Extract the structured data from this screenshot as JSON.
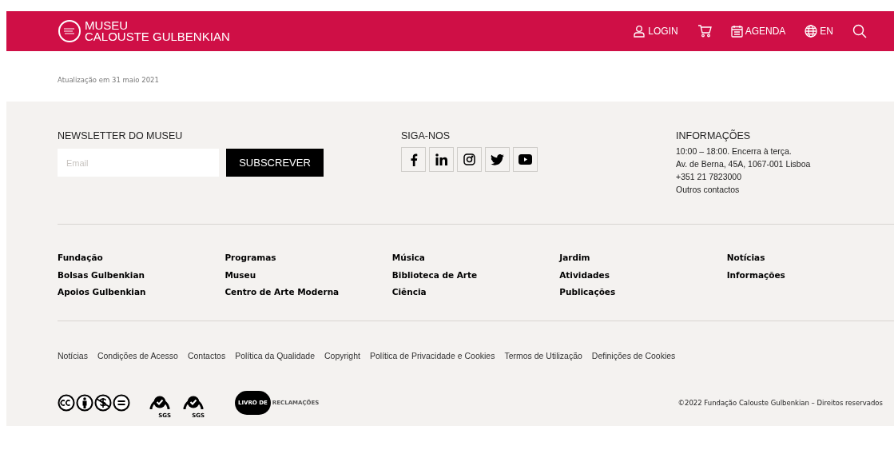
{
  "header": {
    "logo_lines": [
      "MUSEU",
      "CALOUSTE GULBENKIAN"
    ],
    "nav": [
      {
        "kind": "user",
        "label": "LOGIN"
      },
      {
        "kind": "cart"
      },
      {
        "kind": "calendar",
        "label": "AGENDA"
      },
      {
        "kind": "globe",
        "label": "EN"
      },
      {
        "kind": "search"
      }
    ]
  },
  "updated": "Atualização em 31 maio 2021",
  "newsletter": {
    "title": "NEWSLETTER DO MUSEU",
    "placeholder": "Email",
    "button": "SUBSCREVER"
  },
  "social": {
    "title": "SIGA-NOS",
    "links": [
      {
        "kind": "facebook"
      },
      {
        "kind": "linkedin"
      },
      {
        "kind": "instagram"
      },
      {
        "kind": "twitter"
      },
      {
        "kind": "youtube"
      }
    ]
  },
  "info": {
    "title": "INFORMAÇÕES",
    "lines": [
      "10:00 – 18:00. Encerra à terça.",
      "Av. de Berna, 45A, 1067-001 Lisboa",
      "+351 21 7823000"
    ],
    "link": "Outros contactos"
  },
  "link_columns": [
    [
      "Fundação",
      "Bolsas Gulbenkian",
      "Apoios Gulbenkian"
    ],
    [
      "Programas",
      "Museu",
      "Centro de Arte Moderna"
    ],
    [
      "Música",
      "Biblioteca de Arte",
      "Ciência"
    ],
    [
      "Jardim",
      "Atividades",
      "Publicações"
    ],
    [
      "Notícias",
      "Informações"
    ]
  ],
  "legal_links": [
    "Notícias",
    "Condições de Acesso",
    "Contactos",
    "Política da Qualidade",
    "Copyright",
    "Política de Privacidade e Cookies",
    "Termos de Utilização",
    "Definições de Cookies"
  ],
  "certifications": [
    "SGS",
    "SGS"
  ],
  "complaints_book": [
    "LIVRO DE",
    "RECLAMAÇÕES"
  ],
  "copyright": "©2022 Fundação Calouste Gulbenkian – Direitos reservados"
}
